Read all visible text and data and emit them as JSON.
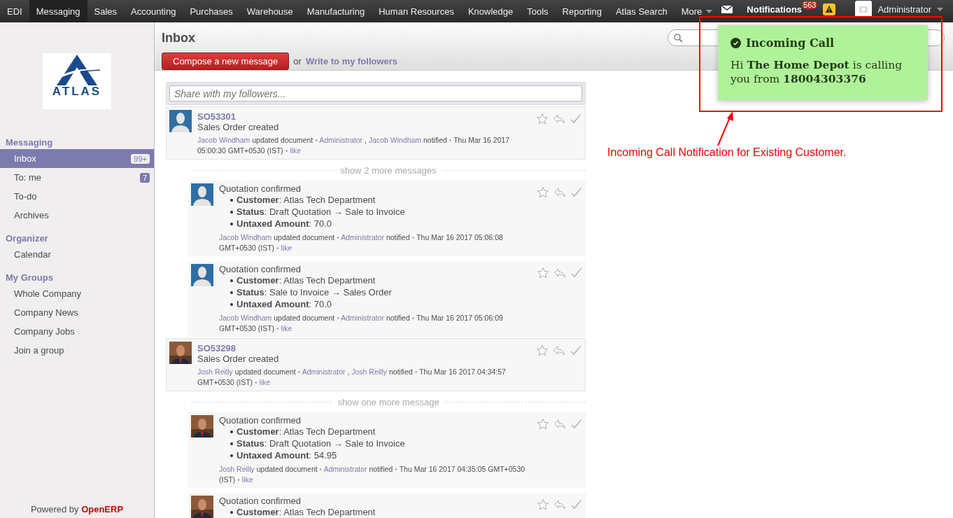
{
  "top_menu": [
    {
      "label": "EDI",
      "selected": false
    },
    {
      "label": "Messaging",
      "selected": true
    },
    {
      "label": "Sales",
      "selected": false
    },
    {
      "label": "Accounting",
      "selected": false
    },
    {
      "label": "Purchases",
      "selected": false
    },
    {
      "label": "Warehouse",
      "selected": false
    },
    {
      "label": "Manufacturing",
      "selected": false
    },
    {
      "label": "Human Resources",
      "selected": false
    },
    {
      "label": "Knowledge",
      "selected": false
    },
    {
      "label": "Tools",
      "selected": false
    },
    {
      "label": "Reporting",
      "selected": false
    },
    {
      "label": "Atlas Search",
      "selected": false
    },
    {
      "label": "More",
      "selected": false
    }
  ],
  "top_right": {
    "notifications": "Notifications",
    "count": "563",
    "user": "Administrator"
  },
  "sidebar": {
    "logo_text": "ATLAS",
    "sections": [
      {
        "title": "Messaging",
        "items": [
          {
            "label": "Inbox",
            "selected": true,
            "badge": "99+"
          },
          {
            "label": "To: me",
            "selected": false,
            "badge": "7"
          },
          {
            "label": "To-do",
            "selected": false
          },
          {
            "label": "Archives",
            "selected": false
          }
        ]
      },
      {
        "title": "Organizer",
        "items": [
          {
            "label": "Calendar",
            "selected": false
          }
        ]
      },
      {
        "title": "My Groups",
        "items": [
          {
            "label": "Whole Company",
            "selected": false
          },
          {
            "label": "Company News",
            "selected": false
          },
          {
            "label": "Company Jobs",
            "selected": false
          },
          {
            "label": "Join a group",
            "selected": false
          }
        ]
      }
    ],
    "footer": {
      "prefix": "Powered by",
      "brand": "OpenERP"
    }
  },
  "header": {
    "title": "Inbox",
    "compose": "Compose a new message",
    "or": "or",
    "followers_link": "Write to my followers"
  },
  "share": {
    "placeholder": "Share with my followers..."
  },
  "threads": [
    {
      "kind": "silhouette",
      "title": "SO53301",
      "summary": "Sales Order created",
      "meta": [
        {
          "kind": "link",
          "text": "Jacob Windham"
        },
        {
          "kind": "plain",
          "text": "updated document"
        },
        {
          "kind": "sep",
          "text": "•"
        },
        {
          "kind": "link",
          "text": "Administrator"
        },
        {
          "kind": "plain",
          "text": ","
        },
        {
          "kind": "link",
          "text": "Jacob Windham"
        },
        {
          "kind": "plain",
          "text": "notified"
        },
        {
          "kind": "sep",
          "text": "•"
        },
        {
          "kind": "plain",
          "text": "Thu Mar 16 2017 05:00:30 GMT+0530 (IST)"
        },
        {
          "kind": "sep",
          "text": "•"
        },
        {
          "kind": "link",
          "text": "like"
        }
      ],
      "more": "show 2 more messages",
      "replies": [
        {
          "kind": "silhouette",
          "title": "Quotation confirmed",
          "fields": [
            "**Customer**: Atlas Tech Department",
            "**Status**: Draft Quotation → Sale to Invoice",
            "**Untaxed Amount**: 70.0"
          ],
          "meta": [
            {
              "kind": "link",
              "text": "Jacob Windham"
            },
            {
              "kind": "plain",
              "text": "updated document"
            },
            {
              "kind": "sep",
              "text": "•"
            },
            {
              "kind": "link",
              "text": "Administrator"
            },
            {
              "kind": "plain",
              "text": "notified"
            },
            {
              "kind": "sep",
              "text": "•"
            },
            {
              "kind": "plain",
              "text": "Thu Mar 16 2017 05:06:08 GMT+0530 (IST)"
            },
            {
              "kind": "sep",
              "text": "•"
            },
            {
              "kind": "link",
              "text": "like"
            }
          ]
        },
        {
          "kind": "silhouette",
          "title": "Quotation confirmed",
          "fields": [
            "**Customer**: Atlas Tech Department",
            "**Status**: Sale to Invoice → Sales Order",
            "**Untaxed Amount**: 70.0"
          ],
          "meta": [
            {
              "kind": "link",
              "text": "Jacob Windham"
            },
            {
              "kind": "plain",
              "text": "updated document"
            },
            {
              "kind": "sep",
              "text": "•"
            },
            {
              "kind": "link",
              "text": "Administrator"
            },
            {
              "kind": "plain",
              "text": "notified"
            },
            {
              "kind": "sep",
              "text": "•"
            },
            {
              "kind": "plain",
              "text": "Thu Mar 16 2017 05:06:09 GMT+0530 (IST)"
            },
            {
              "kind": "sep",
              "text": "•"
            },
            {
              "kind": "link",
              "text": "like"
            }
          ]
        }
      ]
    },
    {
      "title": "SO53298",
      "summary": "Sales Order created",
      "meta": [
        {
          "kind": "link",
          "text": "Josh Reilly"
        },
        {
          "kind": "plain",
          "text": "updated document"
        },
        {
          "kind": "sep",
          "text": "•"
        },
        {
          "kind": "link",
          "text": "Administrator"
        },
        {
          "kind": "plain",
          "text": ","
        },
        {
          "kind": "link",
          "text": "Josh Reilly"
        },
        {
          "kind": "plain",
          "text": "notified"
        },
        {
          "kind": "sep",
          "text": "•"
        },
        {
          "kind": "plain",
          "text": "Thu Mar 16 2017 04:34:57 GMT+0530 (IST)"
        },
        {
          "kind": "sep",
          "text": "•"
        },
        {
          "kind": "link",
          "text": "like"
        }
      ],
      "more": "show one more message",
      "replies": [
        {
          "title": "Quotation confirmed",
          "fields": [
            "**Customer**: Atlas Tech Department",
            "**Status**: Draft Quotation → Sale to Invoice",
            "**Untaxed Amount**: 54.95"
          ],
          "meta": [
            {
              "kind": "link",
              "text": "Josh Reilly"
            },
            {
              "kind": "plain",
              "text": "updated document"
            },
            {
              "kind": "sep",
              "text": "•"
            },
            {
              "kind": "link",
              "text": "Administrator"
            },
            {
              "kind": "plain",
              "text": "notified"
            },
            {
              "kind": "sep",
              "text": "•"
            },
            {
              "kind": "plain",
              "text": "Thu Mar 16 2017 04:35:05 GMT+0530 (IST)"
            },
            {
              "kind": "sep",
              "text": "•"
            },
            {
              "kind": "link",
              "text": "like"
            }
          ]
        },
        {
          "title": "Quotation confirmed",
          "fields": [
            "**Customer**: Atlas Tech Department"
          ]
        }
      ]
    }
  ],
  "notification": {
    "title": "Incoming Call",
    "body": "Hi **The Home Depot** is calling you from **18004303376**"
  },
  "annotation": {
    "caption": "Incoming Call Notification for Existing Customer."
  }
}
